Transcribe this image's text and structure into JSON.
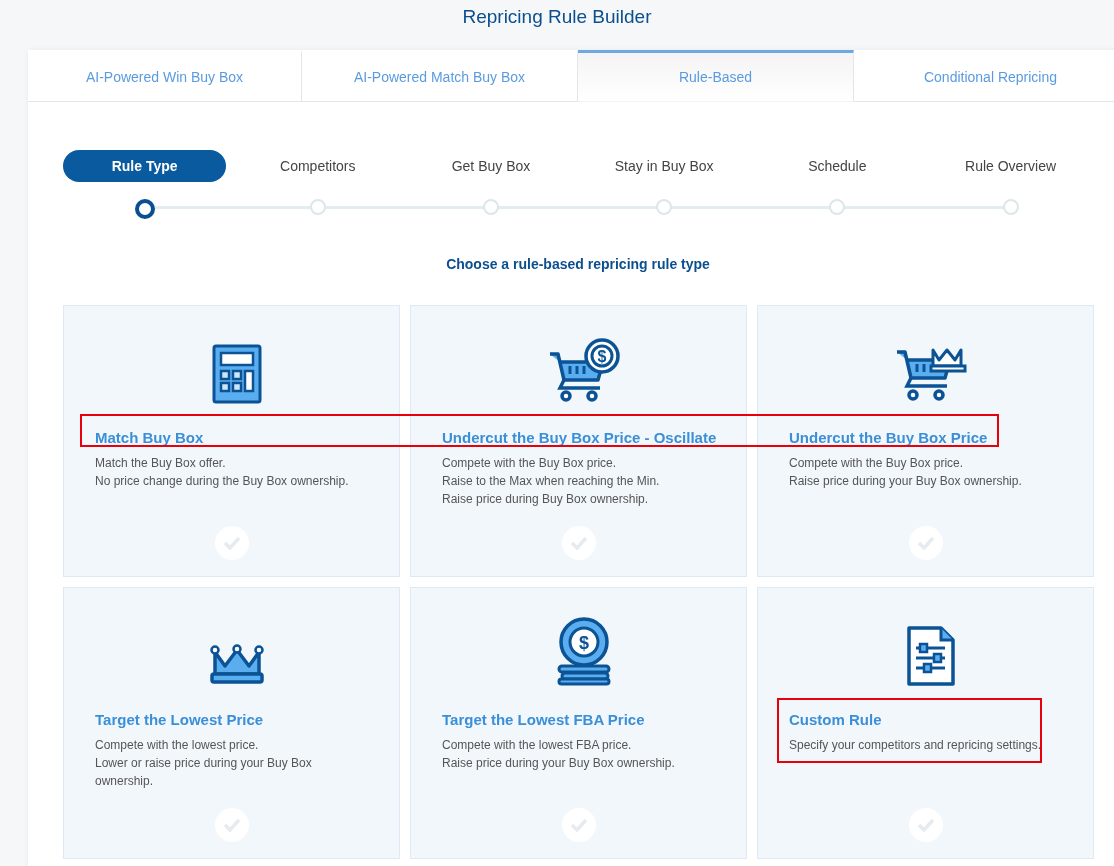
{
  "title": "Repricing Rule Builder",
  "tabs": [
    {
      "label": "AI-Powered Win Buy Box",
      "selected": false
    },
    {
      "label": "AI-Powered Match Buy Box",
      "selected": false
    },
    {
      "label": "Rule-Based",
      "selected": true
    },
    {
      "label": "Conditional Repricing",
      "selected": false
    }
  ],
  "steps": [
    {
      "label": "Rule Type",
      "selected": true
    },
    {
      "label": "Competitors",
      "selected": false
    },
    {
      "label": "Get Buy Box",
      "selected": false
    },
    {
      "label": "Stay in Buy Box",
      "selected": false
    },
    {
      "label": "Schedule",
      "selected": false
    },
    {
      "label": "Rule Overview",
      "selected": false
    }
  ],
  "heading": "Choose a rule-based repricing rule type",
  "cards": [
    {
      "kind": "calculator",
      "title": "Match Buy Box",
      "lines": [
        "Match the Buy Box offer.",
        "No price change during the Buy Box ownership."
      ],
      "selected": false
    },
    {
      "kind": "cartcoin",
      "icon_text": "$",
      "title": "Undercut the Buy Box Price - Oscillate",
      "lines": [
        "Compete with the Buy Box price.",
        "Raise to the Max when reaching the Min.",
        "Raise price during Buy Box ownership."
      ],
      "selected": false
    },
    {
      "kind": "cartcrown",
      "title": "Undercut the Buy Box Price",
      "lines": [
        "Compete with the Buy Box price.",
        "Raise price during your Buy Box ownership."
      ],
      "selected": false
    },
    {
      "kind": "crown",
      "title": "Target the Lowest Price",
      "lines": [
        "Compete with the lowest price.",
        "Lower or raise price during your Buy Box ownership."
      ],
      "selected": false
    },
    {
      "kind": "coins",
      "icon_text": "$",
      "title": "Target the Lowest FBA Price",
      "lines": [
        "Compete with the lowest FBA price.",
        "Raise price during your Buy Box ownership."
      ],
      "selected": false
    },
    {
      "kind": "document",
      "title": "Custom Rule",
      "lines": [
        "Specify your competitors and repricing settings."
      ],
      "selected": false
    }
  ]
}
